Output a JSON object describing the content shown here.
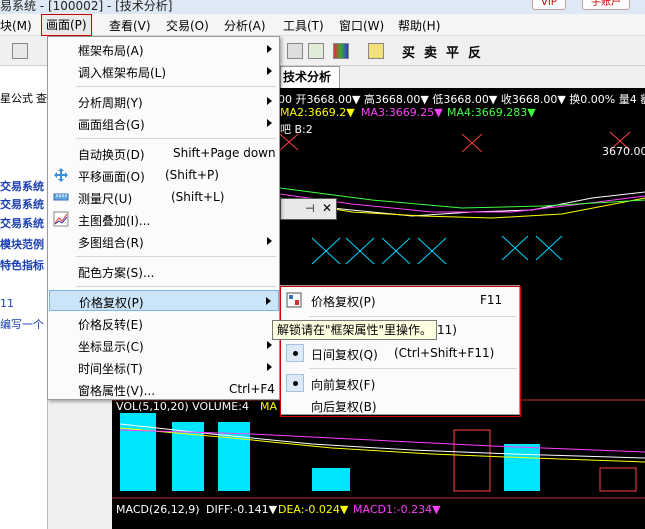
{
  "window": {
    "title": "易系统 - [100002] - [技术分析]",
    "vip_label": "VIP",
    "account_label": "手账户"
  },
  "menubar": {
    "items": [
      "块(M)",
      "画面(P)",
      "查看(V)",
      "交易(O)",
      "分析(A)",
      "工具(T)",
      "窗口(W)",
      "帮助(H)"
    ]
  },
  "toolbar": {
    "buy": "买",
    "sell": "卖",
    "flat": "平",
    "reverse": "反"
  },
  "left_panel": {
    "header_a": "星公式",
    "header_b": "查",
    "items": [
      "交易系统",
      "交易系统",
      "交易系统",
      "模块范例",
      "特色指标"
    ],
    "number": "11",
    "note": "编写一个"
  },
  "chart": {
    "tab": "技术分析",
    "info_line": "00 开3668.00▼ 高3668.00▼ 低3668.00▼ 收3668.00▼ 换0.00% 量4 额",
    "ma2": "MA2:3669.2▼",
    "ma3": "MA3:3669.25▼",
    "ma4": "MA4:3669.283▼",
    "b_label": "吧 B:2",
    "price_tag": "3670.00",
    "vol_label": "VOL(5,10,20) VOLUME:4",
    "vol_ma": "MA",
    "macd_label": "MACD(26,12,9)",
    "diff": "DIFF:-0.141▼",
    "dea": "DEA:-0.024▼",
    "macd1": "MACD1:-0.234▼"
  },
  "menu": {
    "items": [
      {
        "label": "框架布局(A)",
        "shortcut": "",
        "submenu": true
      },
      {
        "label": "调入框架布局(L)",
        "shortcut": "",
        "submenu": true
      },
      {
        "label": "分析周期(Y)",
        "shortcut": "",
        "submenu": true
      },
      {
        "label": "画面组合(G)",
        "shortcut": "",
        "submenu": true
      },
      {
        "label": "自动换页(D)",
        "shortcut": "Shift+Page down",
        "submenu": false
      },
      {
        "label": "平移画面(O)",
        "shortcut": "(Shift+P)",
        "submenu": false
      },
      {
        "label": "测量尺(U)",
        "shortcut": "(Shift+L)",
        "submenu": false
      },
      {
        "label": "主图叠加(I)...",
        "shortcut": "",
        "submenu": false
      },
      {
        "label": "多图组合(R)",
        "shortcut": "",
        "submenu": true
      },
      {
        "label": "配色方案(S)...",
        "shortcut": "",
        "submenu": false
      },
      {
        "label": "价格复权(P)",
        "shortcut": "",
        "submenu": true
      },
      {
        "label": "价格反转(E)",
        "shortcut": "",
        "submenu": false
      },
      {
        "label": "坐标显示(C)",
        "shortcut": "",
        "submenu": true
      },
      {
        "label": "时间坐标(T)",
        "shortcut": "",
        "submenu": true
      },
      {
        "label": "窗格属性(V)...",
        "shortcut": "Ctrl+F4",
        "submenu": false
      }
    ]
  },
  "submenu": {
    "items": [
      {
        "label": "价格复权(P)",
        "shortcut": "F11"
      },
      {
        "label": "",
        "shortcut": "ift+F11)"
      },
      {
        "label": "日间复权(Q)",
        "shortcut": "(Ctrl+Shift+F11)"
      },
      {
        "label": "向前复权(F)",
        "shortcut": ""
      },
      {
        "label": "向后复权(B)",
        "shortcut": ""
      }
    ]
  },
  "tooltip": "解锁请在\"框架属性\"里操作。",
  "colors": {
    "ma_white": "#ffffff",
    "ma_yellow": "#ffff00",
    "ma_magenta": "#ff00ff",
    "ma_green": "#00ff00",
    "cyan": "#00ffff",
    "red": "#ff4040"
  }
}
